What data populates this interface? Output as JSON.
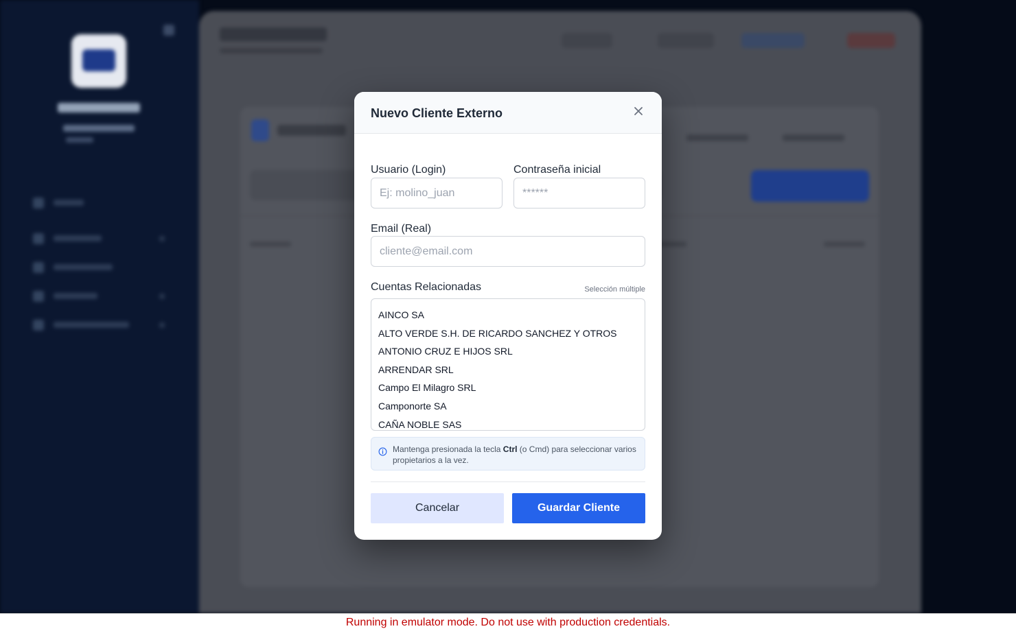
{
  "modal": {
    "title": "Nuevo Cliente Externo",
    "close_icon": "close-icon",
    "username": {
      "label": "Usuario (Login)",
      "placeholder": "Ej: molino_juan",
      "value": ""
    },
    "password": {
      "label": "Contraseña inicial",
      "placeholder": "******",
      "value": ""
    },
    "email": {
      "label": "Email (Real)",
      "placeholder": "cliente@email.com",
      "value": ""
    },
    "accounts": {
      "label": "Cuentas Relacionadas",
      "hint": "Selección múltiple",
      "options": [
        "AINCO SA",
        "ALTO VERDE S.H. DE RICARDO SANCHEZ Y OTROS",
        "ANTONIO CRUZ E HIJOS SRL",
        "ARRENDAR SRL",
        "Campo El Milagro SRL",
        "Camponorte SA",
        "CAÑA NOBLE SAS"
      ]
    },
    "info": {
      "icon": "info-icon",
      "text_before": "Mantenga presionada la tecla ",
      "key": "Ctrl",
      "text_after": " (o Cmd) para seleccionar varios propietarios a la vez."
    },
    "cancel_label": "Cancelar",
    "save_label": "Guardar Cliente"
  },
  "banner": {
    "text": "Running in emulator mode. Do not use with production credentials."
  },
  "colors": {
    "primary": "#2563eb",
    "cancel_bg": "#e0e7ff",
    "banner_text": "#c00000",
    "sidebar_bg": "#0b1730"
  }
}
